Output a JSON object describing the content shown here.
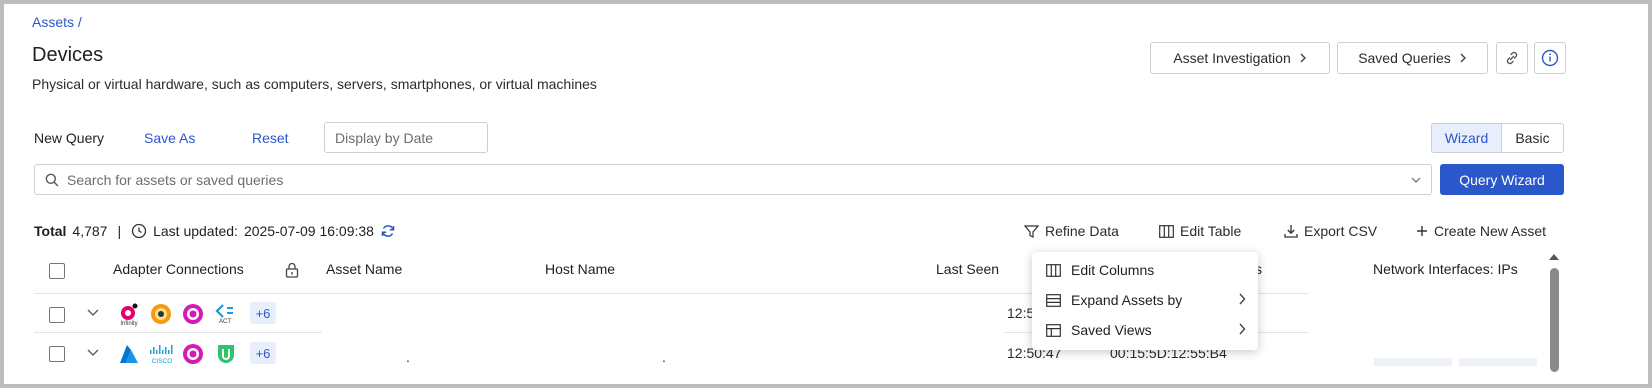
{
  "breadcrumb": "Assets /",
  "page": {
    "title": "Devices",
    "subtitle": "Physical or virtual hardware, such as computers, servers, smartphones, or virtual machines"
  },
  "header_buttons": {
    "asset_investigation": "Asset Investigation",
    "saved_queries": "Saved Queries"
  },
  "query_toolbar": {
    "new_query": "New Query",
    "save_as": "Save As",
    "reset": "Reset",
    "date_placeholder": "Display by Date",
    "mode_wizard": "Wizard",
    "mode_basic": "Basic",
    "active_mode": "Wizard"
  },
  "search": {
    "placeholder": "Search for assets or saved queries",
    "wizard_button": "Query Wizard"
  },
  "status": {
    "total_label": "Total",
    "total_count": "4,787",
    "separator": "|",
    "last_updated_label": "Last updated:",
    "last_updated_value": "2025-07-09 16:09:38"
  },
  "actions": {
    "refine": "Refine Data",
    "edit_table": "Edit Table",
    "export_csv": "Export CSV",
    "create_asset": "Create New Asset"
  },
  "table": {
    "columns": {
      "adapters": "Adapter Connections",
      "asset_name": "Asset Name",
      "host_name": "Host Name",
      "last_seen": "Last Seen",
      "mac_partial": "s",
      "ips": "Network Interfaces: IPs"
    },
    "rows": [
      {
        "adapters": [
          "infinity-logo",
          "sun-logo",
          "pink-ring-logo",
          "act-logo"
        ],
        "adapter_caption_1": "Infinity",
        "adapter_caption_4": "ACT",
        "more": "+6",
        "asset_name": "",
        "host_name": "",
        "last_seen": "12:5",
        "mac": ""
      },
      {
        "adapters": [
          "azure-logo",
          "cisco-logo",
          "pink-ring-logo",
          "green-shield-logo"
        ],
        "more": "+6",
        "asset_name": ".",
        "host_name": ".",
        "last_seen": "12:50:47",
        "mac": "00:15:5D:12:55:B4"
      }
    ]
  },
  "dropdown_menu": {
    "items": [
      {
        "label": "Edit Columns"
      },
      {
        "label": "Expand Assets by"
      },
      {
        "label": "Saved Views"
      }
    ]
  },
  "colors": {
    "accent": "#2a57c9",
    "border": "#cfcfcf",
    "text": "#1f1f1f"
  }
}
